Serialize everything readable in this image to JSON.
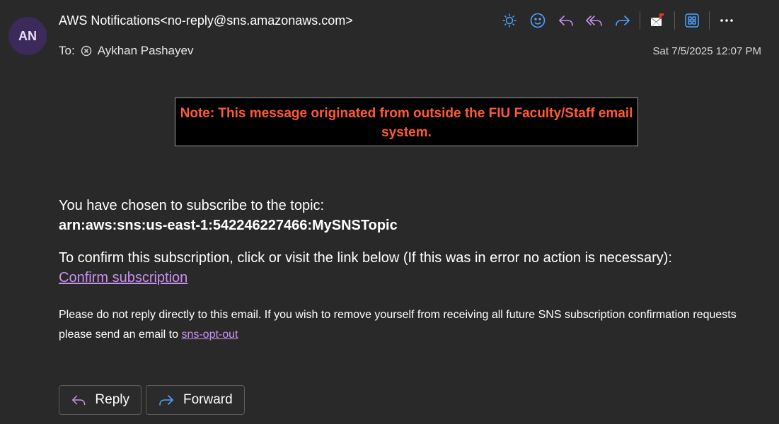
{
  "header": {
    "avatar_initials": "AN",
    "sender": "AWS Notifications<no-reply@sns.amazonaws.com>",
    "to_label": "To:",
    "recipient": "Aykhan Pashayev",
    "datetime": "Sat 7/5/2025 12:07 PM"
  },
  "toolbar": {
    "icons": [
      "brightness-icon",
      "emoji-icon",
      "reply-icon",
      "reply-all-icon",
      "forward-icon",
      "report-icon",
      "apps-icon",
      "more-icon"
    ],
    "accent_color": "#4da3ff",
    "purple_color": "#c891f0"
  },
  "banner": {
    "text": "Note: This message originated from outside the FIU Faculty/Staff email system.",
    "color": "#ff5a36"
  },
  "message": {
    "intro": "You have chosen to subscribe to the topic:",
    "topic_arn": "arn:aws:sns:us-east-1:542246227466:MySNSTopic",
    "confirm_text": "To confirm this subscription, click or visit the link below (If this was in error no action is necessary):",
    "confirm_link": "Confirm subscription",
    "footer_text": "Please do not reply directly to this email. If you wish to remove yourself from receiving all future SNS subscription confirmation requests please send an email to",
    "opt_out_link": "sns-opt-out"
  },
  "actions": {
    "reply_label": "Reply",
    "forward_label": "Forward"
  }
}
